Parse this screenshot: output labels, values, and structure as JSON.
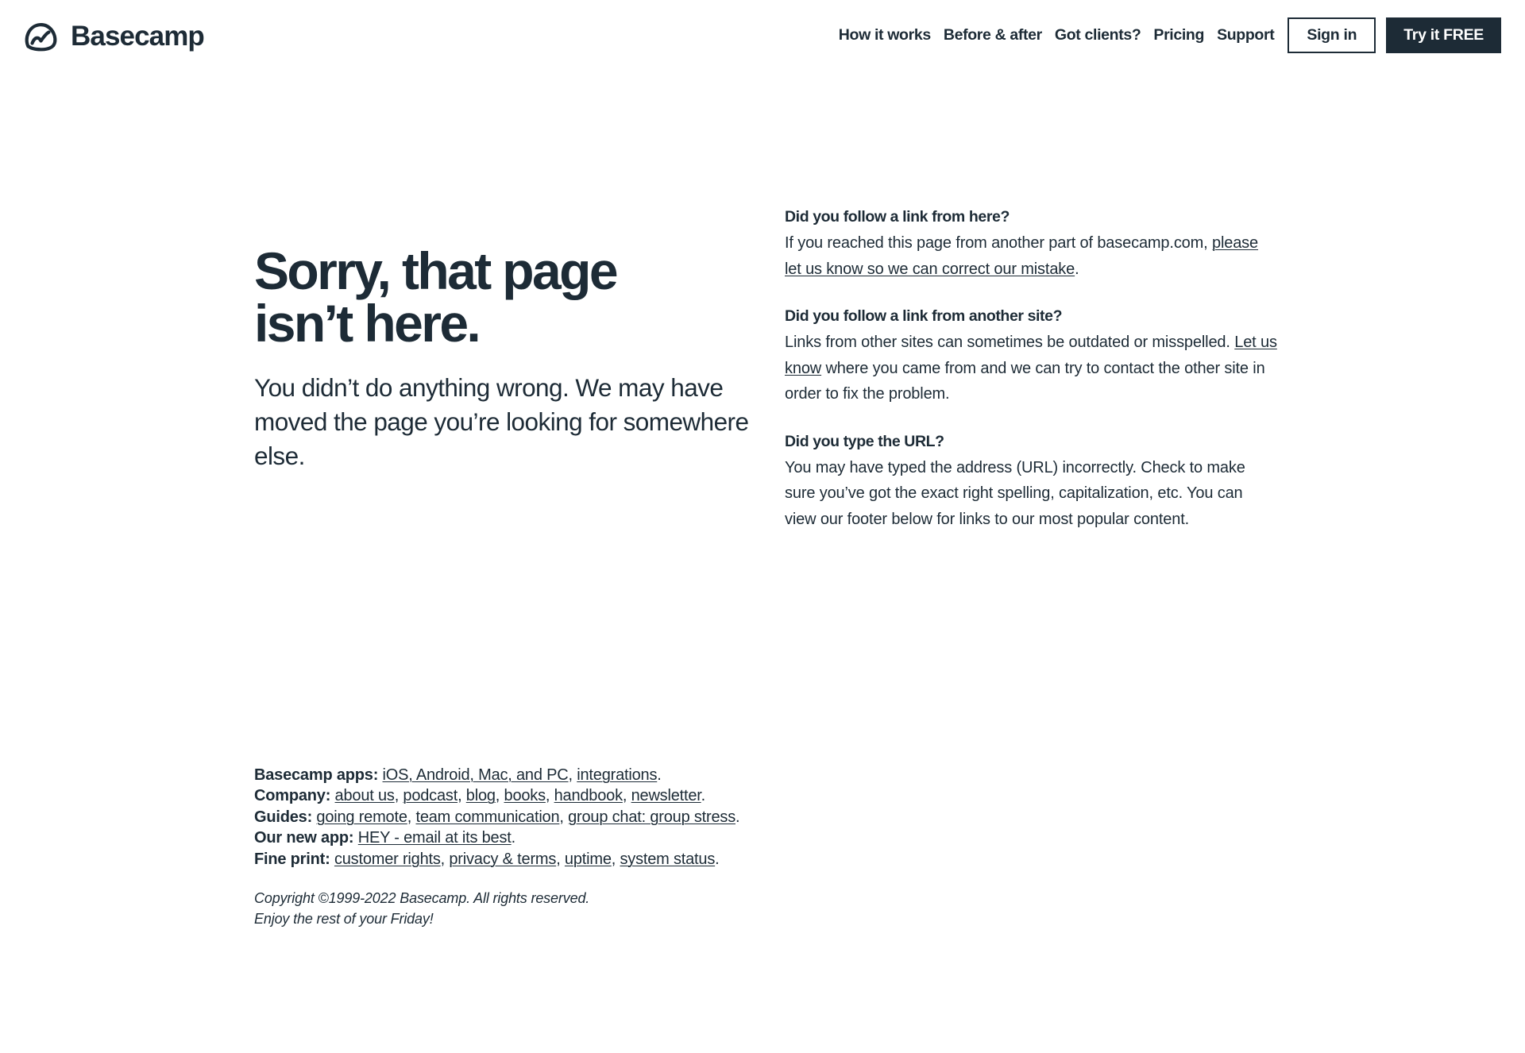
{
  "header": {
    "brand": {
      "name": "Basecamp",
      "icon": "basecamp-logo-icon",
      "color": "#1d2b36"
    },
    "nav": [
      {
        "label": "How it works"
      },
      {
        "label": "Before & after"
      },
      {
        "label": "Got clients?"
      },
      {
        "label": "Pricing"
      },
      {
        "label": "Support"
      }
    ],
    "sign_in_label": "Sign in",
    "trial_label": "Try it FREE"
  },
  "hero": {
    "title_line_1": "Sorry, that page",
    "title_line_2": "isn’t here.",
    "subtitle": "You didn’t do anything wrong. We may have moved the page you’re looking for somewhere else."
  },
  "faq": [
    {
      "question": "Did you follow a link from here?",
      "answer_pre": "If you reached this page from another part of basecamp.com, ",
      "link": "please let us know so we can correct our mistake",
      "answer_post": "."
    },
    {
      "question": "Did you follow a link from another site?",
      "answer_pre": "Links from other sites can sometimes be outdated or misspelled. ",
      "link": "Let us know",
      "answer_post": " where you came from and we can try to contact the other site in order to fix the problem."
    },
    {
      "question": "Did you type the URL?",
      "answer_pre": "You may have typed the address (URL) incorrectly. Check to make sure you’ve got the exact right spelling, capitalization, etc. You can view our footer below for links to our most popular content.",
      "link": "",
      "answer_post": ""
    }
  ],
  "footer": {
    "rows": [
      {
        "label": "Basecamp apps:",
        "links": [
          "iOS, Android, Mac, and PC",
          "integrations"
        ],
        "separators": [
          ", ",
          "."
        ]
      },
      {
        "label": "Company:",
        "links": [
          "about us",
          "podcast",
          "blog",
          "books",
          "handbook",
          "newsletter"
        ],
        "separators": [
          ", ",
          ", ",
          ", ",
          ", ",
          ", ",
          "."
        ]
      },
      {
        "label": "Guides:",
        "links": [
          "going remote",
          "team communication",
          "group chat: group stress"
        ],
        "separators": [
          ", ",
          ", ",
          "."
        ]
      },
      {
        "label": "Our new app:",
        "links": [
          "HEY - email at its best"
        ],
        "separators": [
          "."
        ]
      },
      {
        "label": "Fine print:",
        "links": [
          "customer rights",
          "privacy & terms",
          "uptime",
          "system status"
        ],
        "separators": [
          ", ",
          ", ",
          ", ",
          "."
        ]
      }
    ],
    "copyright": "Copyright ©1999-2022 Basecamp. All rights reserved.",
    "signoff": "Enjoy the rest of your Friday!"
  }
}
